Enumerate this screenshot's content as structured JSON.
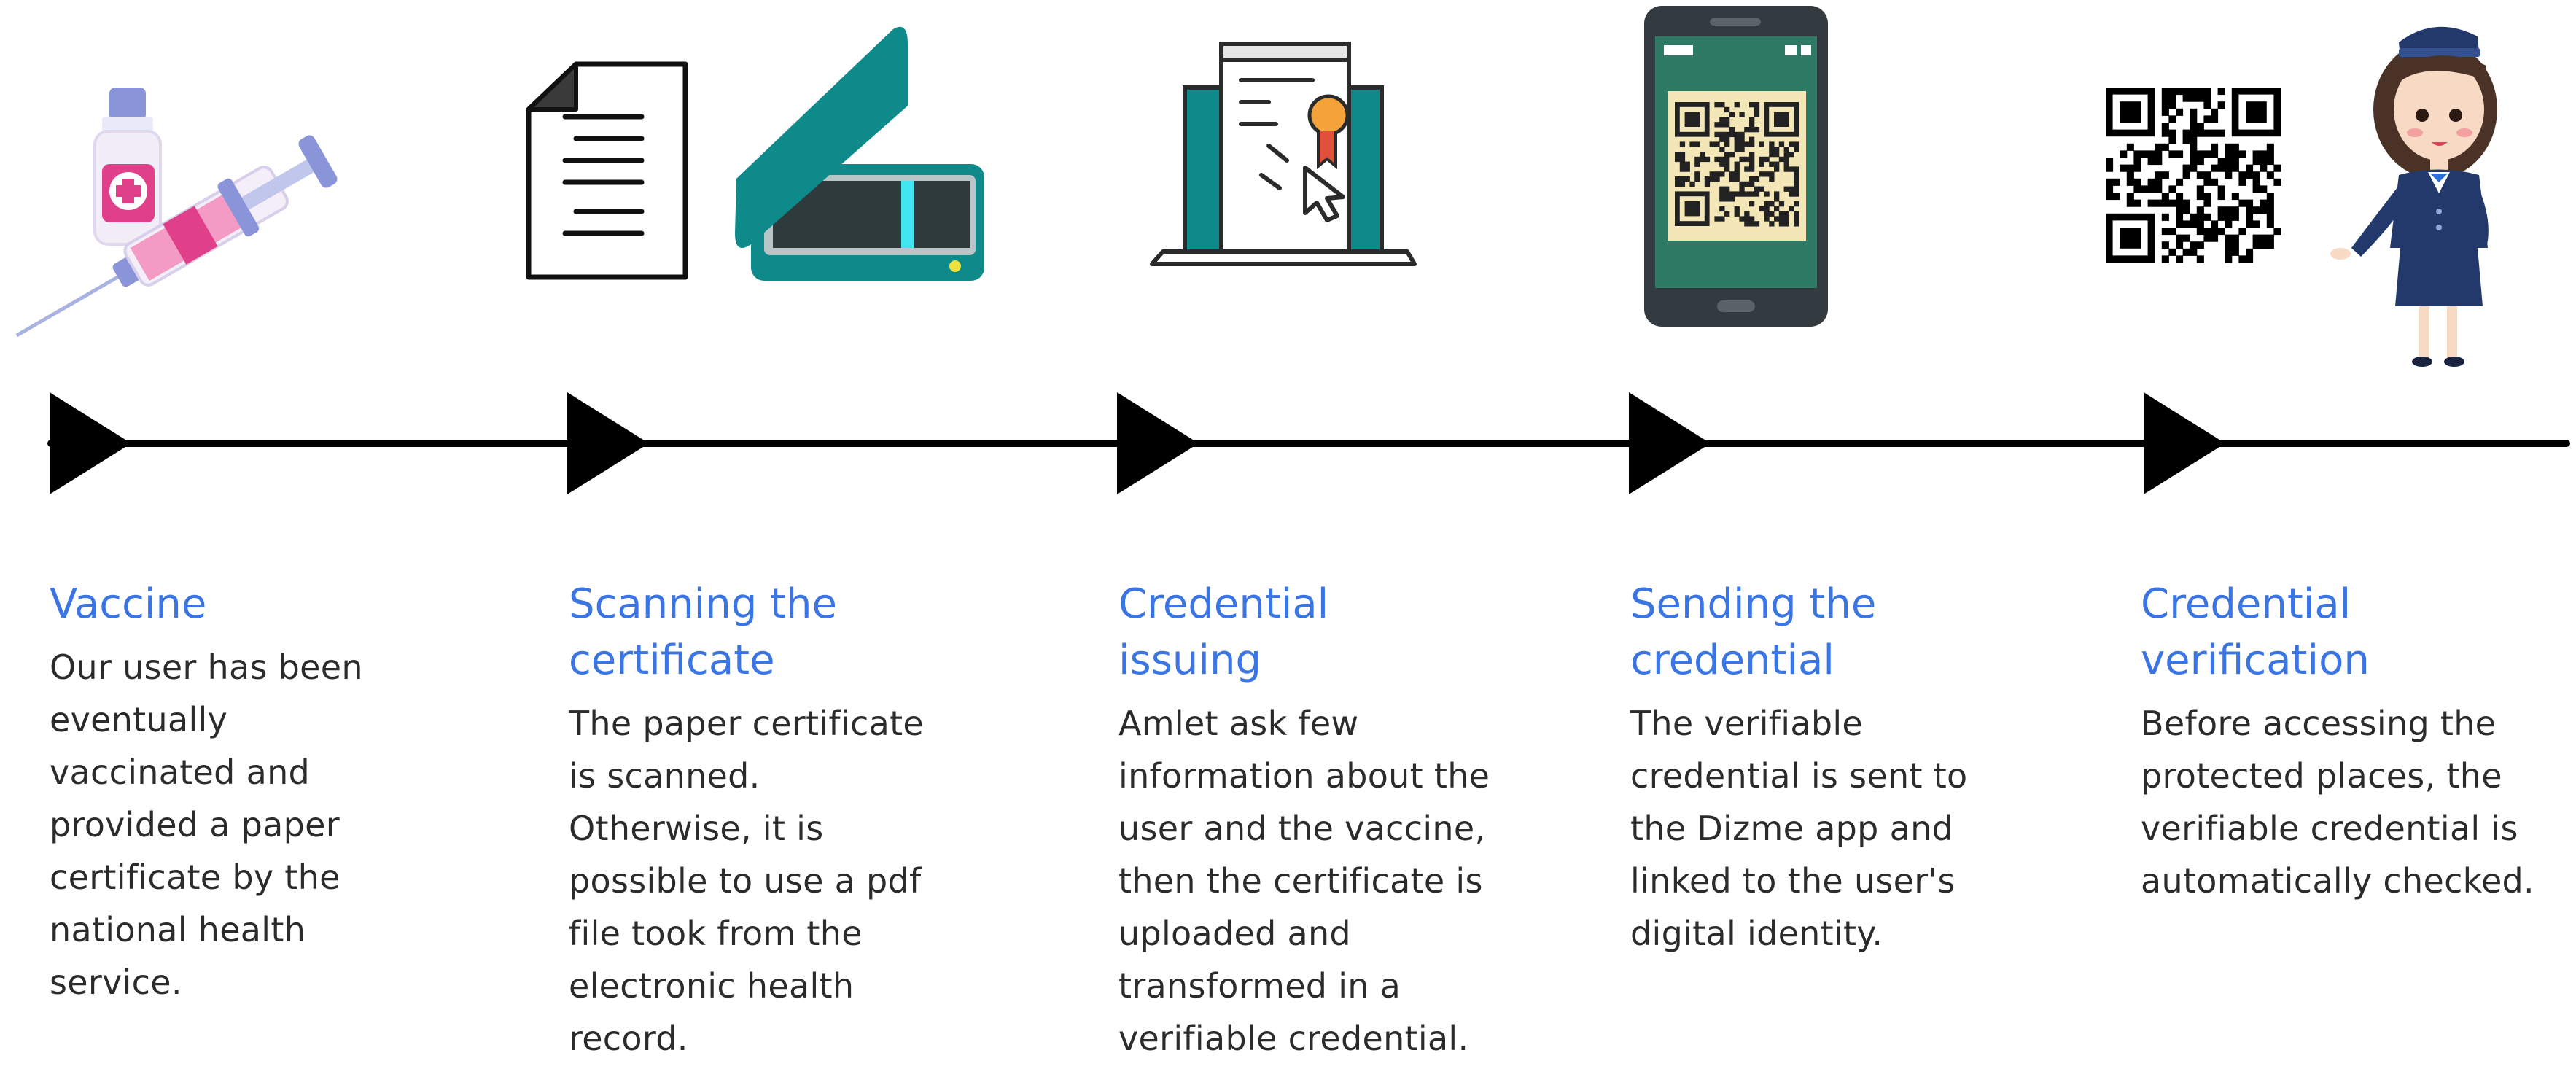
{
  "colors": {
    "title": "#3b74e3",
    "text": "#2b2b2b",
    "timeline": "#000000",
    "teal": "#0f8a8a",
    "pink": "#e0408a",
    "phone": "#333a40",
    "screen": "#2f7a64",
    "qr_bg": "#f3e7b8",
    "navy": "#23396b"
  },
  "steps": [
    {
      "title": "Vaccine",
      "description": "Our user has been\neventually\nvaccinated and\nprovided a paper\ncertificate by the\nnational health\nservice.",
      "icon": "vaccine-syringe-icon"
    },
    {
      "title": "Scanning the\ncertificate",
      "description": "The paper certificate\nis scanned.\nOtherwise, it is\npossible to use a pdf\nfile took from the\nelectronic health\nrecord.",
      "icon": "document-scanner-icon"
    },
    {
      "title": "Credential\nissuing",
      "description": "Amlet ask few\ninformation about the\nuser and the vaccine,\nthen the certificate is\nuploaded and\ntransformed in a\nverifiable credential.",
      "icon": "laptop-certificate-icon"
    },
    {
      "title": "Sending the\ncredential",
      "description": "The verifiable\ncredential is sent to\nthe Dizme app and\nlinked to the user's\ndigital identity.",
      "icon": "phone-qr-icon"
    },
    {
      "title": "Credential\nverification",
      "description": "Before accessing the\nprotected places, the\nverifiable credential is\nautomatically checked.",
      "icon": "qr-hostess-icon"
    }
  ]
}
